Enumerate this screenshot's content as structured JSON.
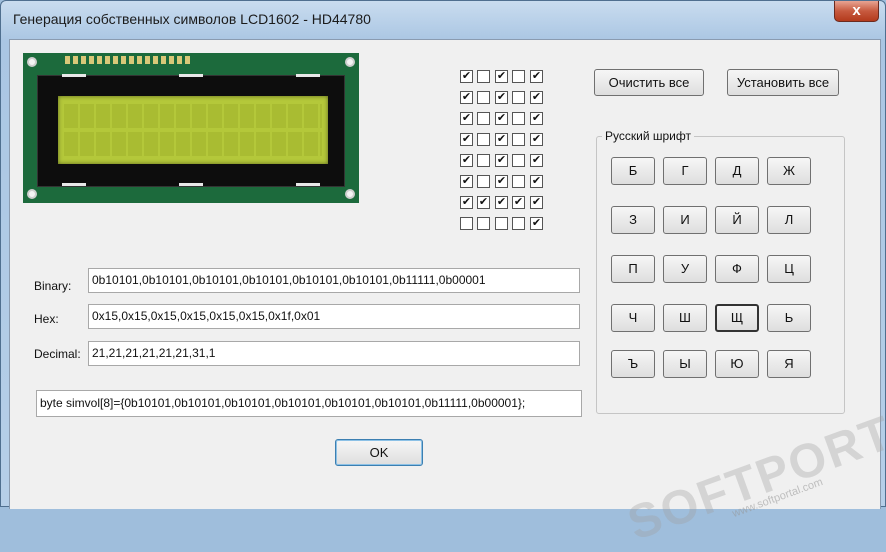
{
  "window": {
    "title": "Генерация собственных символов LCD1602 - HD44780",
    "close_label": "x"
  },
  "buttons": {
    "clear_all": "Очистить все",
    "set_all": "Установить все",
    "ok": "OK"
  },
  "pixel_grid": [
    [
      1,
      0,
      1,
      0,
      1
    ],
    [
      1,
      0,
      1,
      0,
      1
    ],
    [
      1,
      0,
      1,
      0,
      1
    ],
    [
      1,
      0,
      1,
      0,
      1
    ],
    [
      1,
      0,
      1,
      0,
      1
    ],
    [
      1,
      0,
      1,
      0,
      1
    ],
    [
      1,
      1,
      1,
      1,
      1
    ],
    [
      0,
      0,
      0,
      0,
      1
    ]
  ],
  "russian_font": {
    "label": "Русский шрифт",
    "letters": [
      "Б",
      "Г",
      "Д",
      "Ж",
      "З",
      "И",
      "Й",
      "Л",
      "П",
      "У",
      "Ф",
      "Ц",
      "Ч",
      "Ш",
      "Щ",
      "Ь",
      "Ъ",
      "Ы",
      "Ю",
      "Я"
    ],
    "selected": "Щ"
  },
  "fields": {
    "binary_label": "Binary:",
    "binary_value": "0b10101,0b10101,0b10101,0b10101,0b10101,0b10101,0b11111,0b00001",
    "hex_label": "Hex:",
    "hex_value": "0x15,0x15,0x15,0x15,0x15,0x15,0x1f,0x01",
    "decimal_label": "Decimal:",
    "decimal_value": "21,21,21,21,21,21,31,1",
    "code_value": "byte simvol[8]={0b10101,0b10101,0b10101,0b10101,0b10101,0b10101,0b11111,0b00001};"
  },
  "watermark": {
    "brand": "SOFTPORTAL",
    "site": "www.softportal.com"
  },
  "colors": {
    "lcd_green": "#b4c83a",
    "pcb": "#1c6a3c"
  }
}
